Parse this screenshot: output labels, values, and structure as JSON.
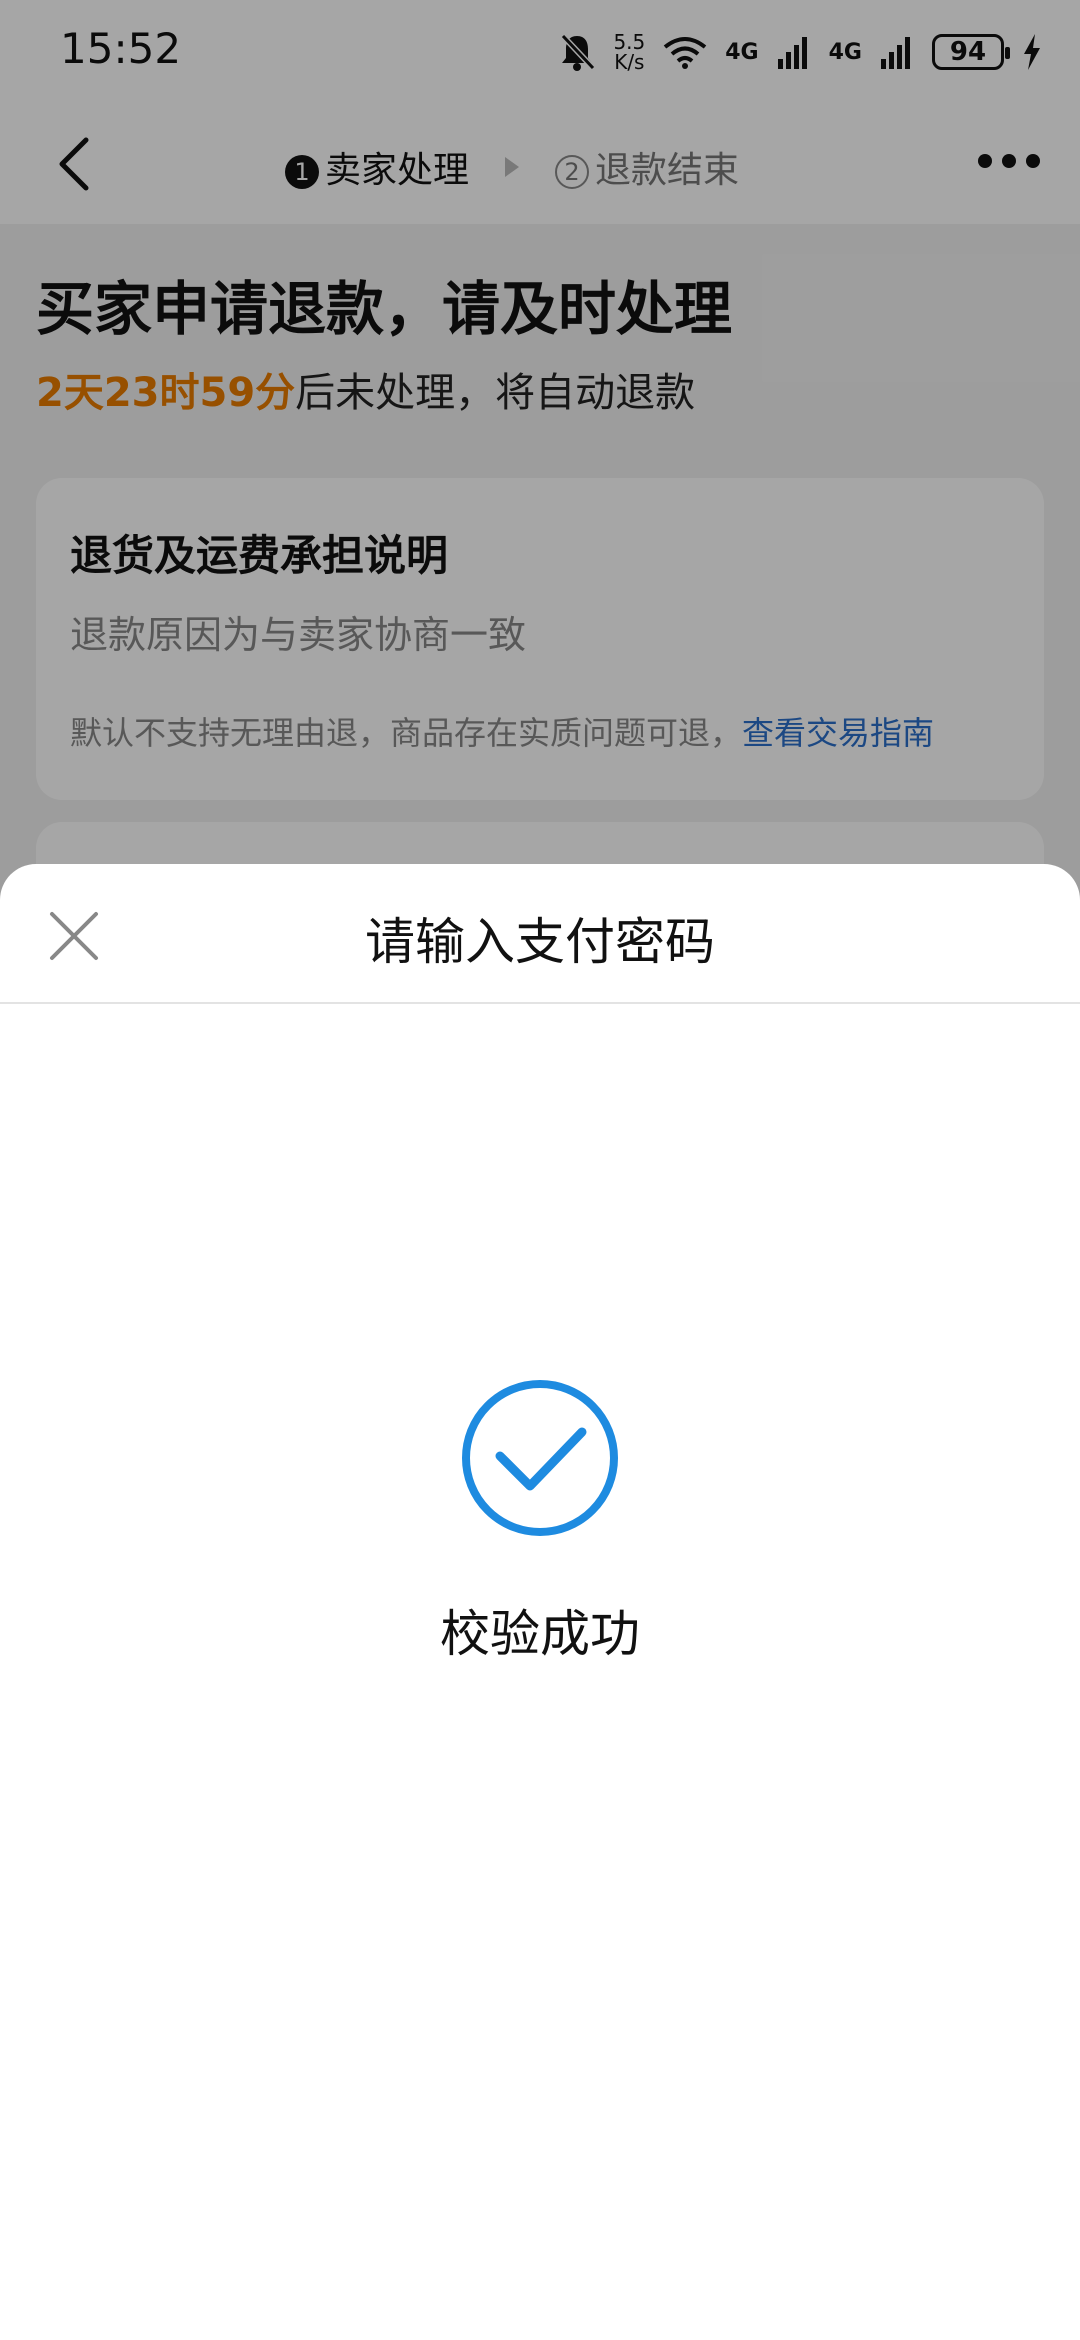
{
  "status_bar": {
    "time": "15:52",
    "speed_value": "5.5",
    "speed_unit": "K/s",
    "network_1": "4G",
    "network_2": "4G",
    "battery": "94",
    "icons": [
      "bell-off-icon",
      "wifi-icon",
      "signal-icon",
      "signal-icon",
      "battery-icon",
      "charging-icon"
    ]
  },
  "nav": {
    "step1_num": "1",
    "step1_label": "卖家处理",
    "step2_num": "2",
    "step2_label": "退款结束"
  },
  "page": {
    "headline": "买家申请退款，请及时处理",
    "countdown_timer": "2天23时59分",
    "countdown_suffix": "后未处理，将自动退款"
  },
  "card": {
    "title": "退货及运费承担说明",
    "reason": "退款原因为与卖家协商一致",
    "note": "默认不支持无理由退，商品存在实质问题可退，",
    "link": "查看交易指南"
  },
  "sheet": {
    "title": "请输入支付密码",
    "success_text": "校验成功"
  },
  "colors": {
    "accent_orange": "#e87b00",
    "link_blue": "#2b6fc9",
    "success_blue": "#1e8be0"
  }
}
